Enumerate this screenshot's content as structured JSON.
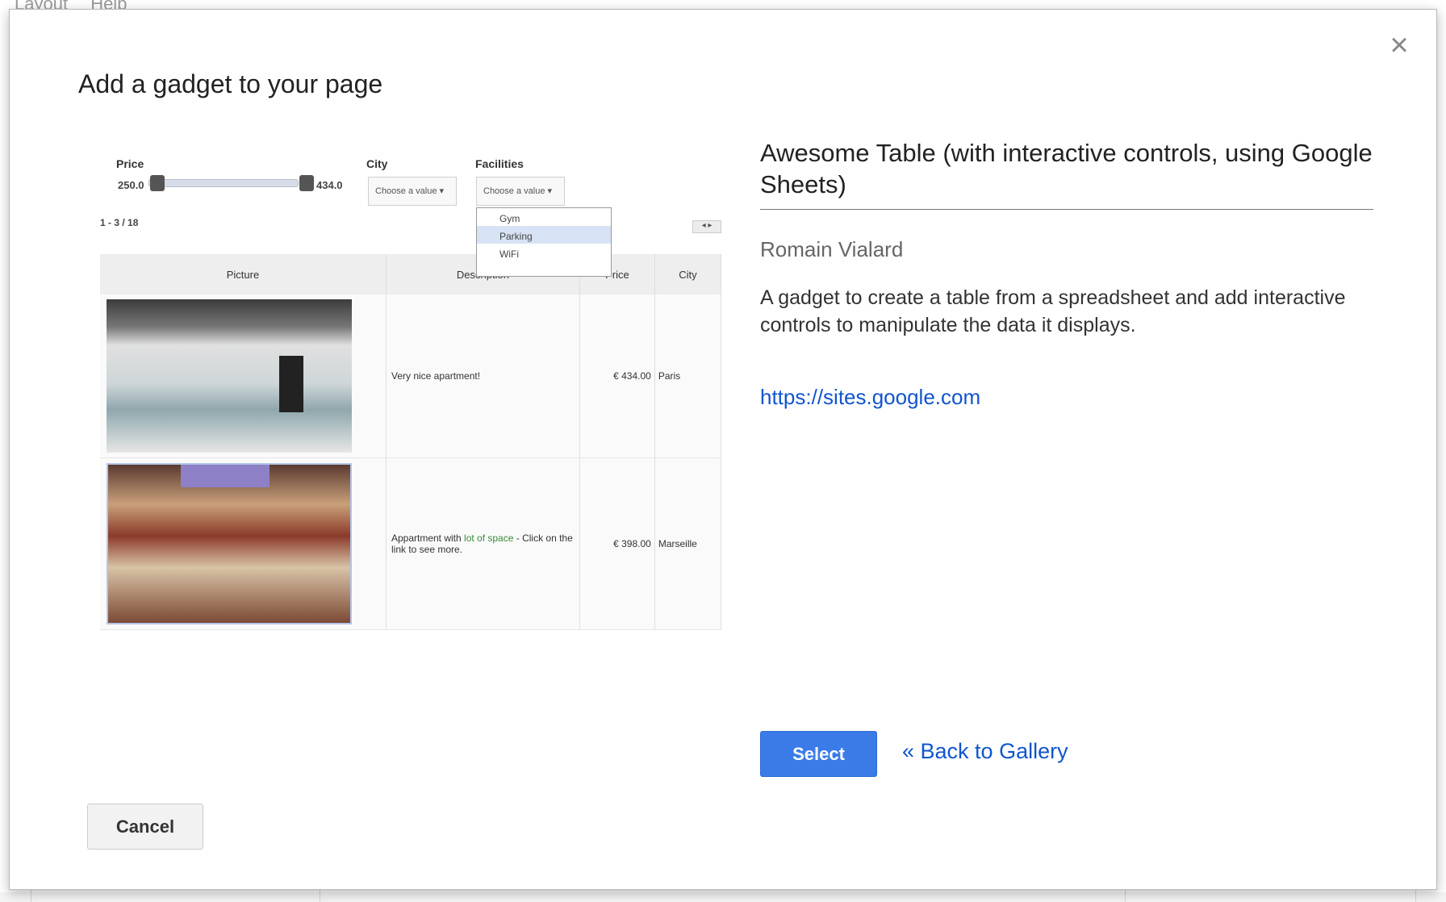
{
  "background_menu": {
    "items": [
      "Layout",
      "Help"
    ]
  },
  "dialog": {
    "title": "Add a gadget to your page",
    "close_symbol": "×",
    "cancel_label": "Cancel"
  },
  "gadget": {
    "name": "Awesome Table (with interactive controls, using Google Sheets)",
    "author": "Romain Vialard",
    "description": "A gadget to create a table from a spreadsheet and add interactive controls to manipulate the data it displays.",
    "link": "https://sites.google.com",
    "select_label": "Select",
    "back_label": "« Back to Gallery"
  },
  "preview": {
    "price_label": "Price",
    "price_min": "250.0",
    "price_max": "434.0",
    "city_label": "City",
    "facilities_label": "Facilities",
    "choose_placeholder": "Choose a value",
    "facilities_options": [
      "Gym",
      "Parking",
      "WiFi"
    ],
    "facilities_highlighted": "Parking",
    "pager_text": "1 - 3 / 18",
    "pager_arrows": "◂ ▸",
    "table_headers": [
      "Picture",
      "Description",
      "Price",
      "City"
    ],
    "rows": [
      {
        "description": "Very nice apartment!",
        "description_link": "",
        "price": "€ 434.00",
        "city": "Paris"
      },
      {
        "description": "Appartment with ",
        "description_link": "lot of space",
        "description_rest": " - Click on the link to see more.",
        "price": "€ 398.00",
        "city": "Marseille"
      }
    ]
  },
  "colors": {
    "link": "#1155cc",
    "select_button": "#3b7be8",
    "dropdown_highlight": "#d7e3f4"
  },
  "icons": {
    "close": "close-icon",
    "dropdown_arrow": "chevron-down-icon",
    "pager": "pager-arrows-icon"
  }
}
